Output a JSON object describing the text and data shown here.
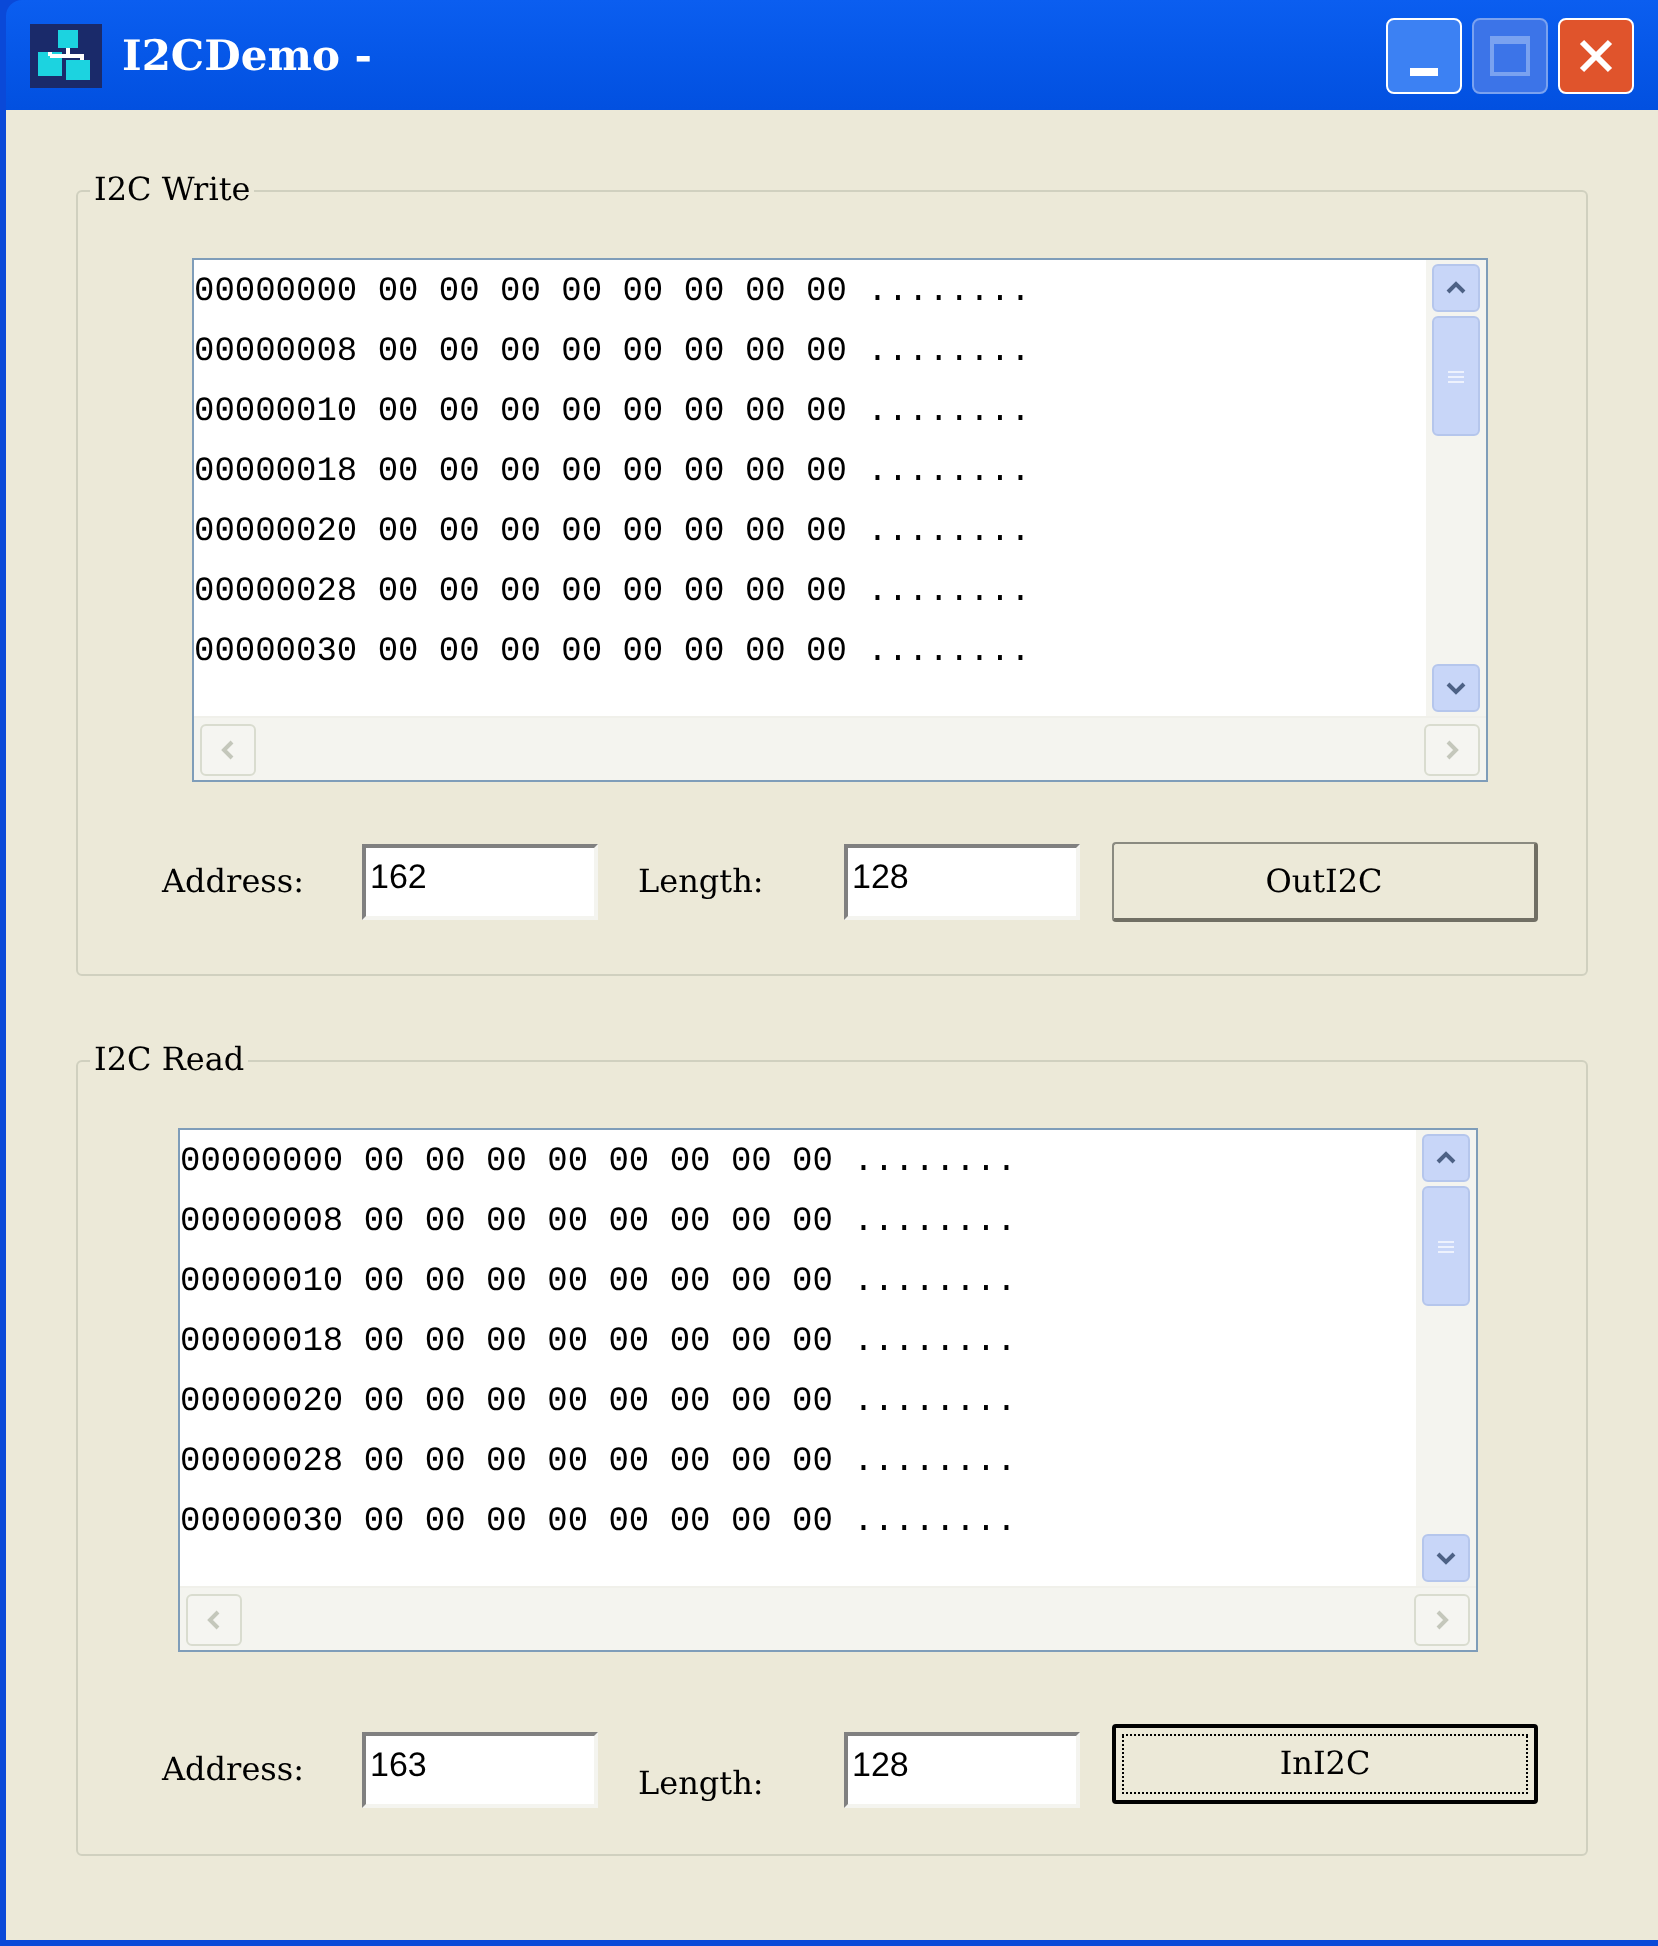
{
  "window": {
    "title": "I2CDemo -"
  },
  "groups": [
    {
      "title": "I2C Write",
      "rows": [
        "00000000 00 00 00 00 00 00 00 00 ........",
        "00000008 00 00 00 00 00 00 00 00 ........",
        "00000010 00 00 00 00 00 00 00 00 ........",
        "00000018 00 00 00 00 00 00 00 00 ........",
        "00000020 00 00 00 00 00 00 00 00 ........",
        "00000028 00 00 00 00 00 00 00 00 ........",
        "00000030 00 00 00 00 00 00 00 00 ........"
      ],
      "address_label": "Address:",
      "address": "162",
      "length_label": "Length:",
      "length": "128",
      "button": {
        "label": "OutI2C",
        "focused": false
      }
    },
    {
      "title": "I2C Read",
      "rows": [
        "00000000 00 00 00 00 00 00 00 00 ........",
        "00000008 00 00 00 00 00 00 00 00 ........",
        "00000010 00 00 00 00 00 00 00 00 ........",
        "00000018 00 00 00 00 00 00 00 00 ........",
        "00000020 00 00 00 00 00 00 00 00 ........",
        "00000028 00 00 00 00 00 00 00 00 ........",
        "00000030 00 00 00 00 00 00 00 00 ........"
      ],
      "address_label": "Address:",
      "address": "163",
      "length_label": "Length:",
      "length": "128",
      "button": {
        "label": "InI2C",
        "focused": true
      }
    }
  ]
}
